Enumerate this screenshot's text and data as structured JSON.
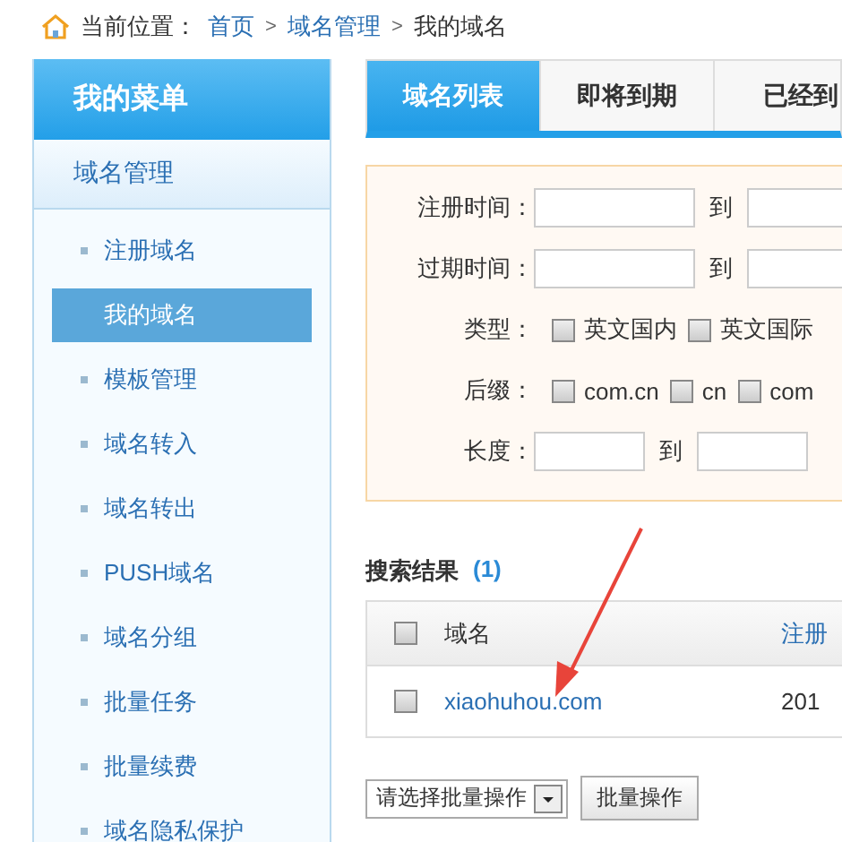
{
  "breadcrumb": {
    "label": "当前位置：",
    "links": [
      "首页",
      "域名管理"
    ],
    "separators": [
      ">",
      ">"
    ],
    "current": "我的域名"
  },
  "sidebar": {
    "title": "我的菜单",
    "section": "域名管理",
    "items": [
      {
        "label": "注册域名",
        "selected": false
      },
      {
        "label": "我的域名",
        "selected": true
      },
      {
        "label": "模板管理",
        "selected": false
      },
      {
        "label": "域名转入",
        "selected": false
      },
      {
        "label": "域名转出",
        "selected": false
      },
      {
        "label": "PUSH域名",
        "selected": false
      },
      {
        "label": "域名分组",
        "selected": false
      },
      {
        "label": "批量任务",
        "selected": false
      },
      {
        "label": "批量续费",
        "selected": false
      },
      {
        "label": "域名隐私保护",
        "selected": false
      }
    ]
  },
  "tabs": [
    {
      "label": "域名列表",
      "selected": true
    },
    {
      "label": "即将到期",
      "selected": false
    },
    {
      "label": "已经到",
      "selected": false
    }
  ],
  "filters": [
    {
      "kind": "range",
      "label": "注册时间：",
      "to": "到"
    },
    {
      "kind": "range",
      "label": "过期时间：",
      "to": "到"
    },
    {
      "kind": "checks",
      "label": "类型：",
      "options": [
        {
          "label": "英文国内",
          "checked": false
        },
        {
          "label": "英文国际",
          "checked": false
        }
      ]
    },
    {
      "kind": "checks",
      "label": "后缀：",
      "options": [
        {
          "label": "com.cn",
          "checked": false
        },
        {
          "label": "cn",
          "checked": false
        },
        {
          "label": "com",
          "checked": false
        }
      ]
    },
    {
      "kind": "short_range",
      "label": "长度：",
      "to": "到"
    }
  ],
  "results": {
    "title": "搜索结果",
    "count": "(1)",
    "header_checked": false,
    "columns": [
      "域名",
      "注册"
    ],
    "rows": [
      {
        "checked": false,
        "domain": "xiaohuhou.com",
        "column_2": "201"
      }
    ]
  },
  "batch": {
    "select": "请选择批量操作",
    "button": "批量操作"
  }
}
